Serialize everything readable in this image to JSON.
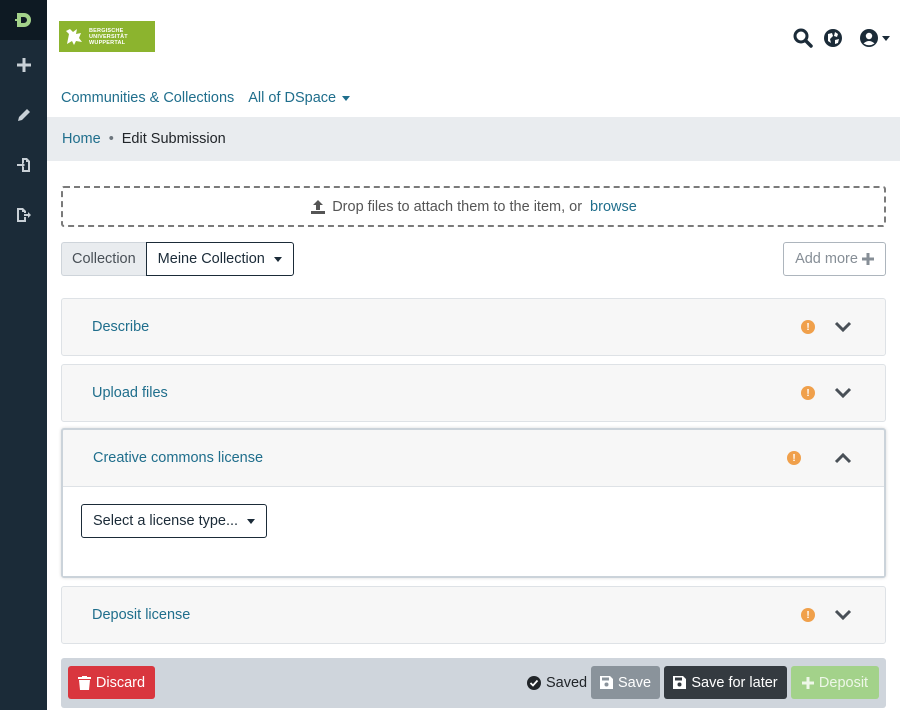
{
  "sidebar": {
    "items": [
      {
        "icon": "dspace-logo-icon"
      },
      {
        "icon": "plus-icon"
      },
      {
        "icon": "pencil-icon"
      },
      {
        "icon": "file-import-icon"
      },
      {
        "icon": "file-export-icon"
      }
    ]
  },
  "header": {
    "logo_text": [
      "BERGISCHE",
      "UNIVERSITÄT",
      "WUPPERTAL"
    ],
    "icons": [
      "search-icon",
      "globe-icon",
      "user-icon"
    ]
  },
  "nav": {
    "communities": "Communities & Collections",
    "all_of": "All of DSpace"
  },
  "breadcrumb": {
    "home": "Home",
    "separator": "•",
    "current": "Edit Submission"
  },
  "dropzone": {
    "text": "Drop files to attach them to the item, or",
    "link": "browse"
  },
  "collection": {
    "label": "Collection",
    "selected": "Meine Collection"
  },
  "add_more": "Add more",
  "sections": [
    {
      "title": "Describe",
      "state": "collapsed"
    },
    {
      "title": "Upload files",
      "state": "collapsed"
    },
    {
      "title": "Creative commons license",
      "state": "expanded",
      "select_placeholder": "Select a license type..."
    },
    {
      "title": "Deposit license",
      "state": "collapsed"
    }
  ],
  "footer": {
    "discard": "Discard",
    "saved": "Saved",
    "save": "Save",
    "save_later": "Save for later",
    "deposit": "Deposit"
  },
  "colors": {
    "sidebar": "#1b2b38",
    "link": "#1f6e8c",
    "warning": "#f0a04b",
    "discard": "#d9363e",
    "deposit": "#a3d28a",
    "brand": "#8cb42e"
  }
}
